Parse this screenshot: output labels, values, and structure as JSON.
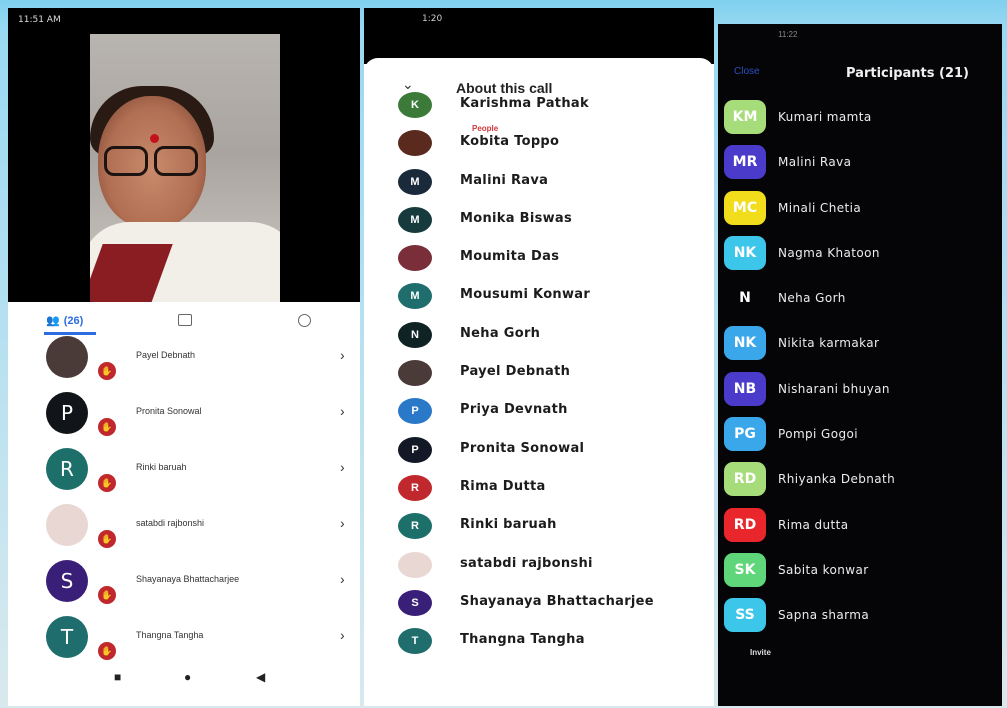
{
  "screen1": {
    "status_text": "11:51 AM",
    "tabs": {
      "people_count": "(26)"
    },
    "participants": [
      {
        "name": "Payel Debnath",
        "initial": "",
        "color": "#4a3a38"
      },
      {
        "name": "Pronita Sonowal",
        "initial": "P",
        "color": "#111418"
      },
      {
        "name": "Rinki baruah",
        "initial": "R",
        "color": "#1d6f6a"
      },
      {
        "name": "satabdi rajbonshi",
        "initial": "",
        "color": "#e9d7d3"
      },
      {
        "name": "Shayanaya Bhattacharjee",
        "initial": "S",
        "color": "#3a1f78"
      },
      {
        "name": "Thangna Tangha",
        "initial": "T",
        "color": "#1f6e6d"
      }
    ],
    "chevron": "›",
    "hand_icon": "✋",
    "nav": {
      "square": "■",
      "home": "●",
      "back": "◀"
    }
  },
  "screen2": {
    "time": "1:20",
    "sheet_title": "About this call",
    "section_label": "People",
    "collapse_glyph": "⌄",
    "participants": [
      {
        "name": "Karishma Pathak",
        "initial": "K",
        "color": "#3c7a3a"
      },
      {
        "name": "Kobita Toppo",
        "initial": "",
        "color": "#5a2a1e"
      },
      {
        "name": "Malini Rava",
        "initial": "M",
        "color": "#1a2a3a"
      },
      {
        "name": "Monika Biswas",
        "initial": "M",
        "color": "#173a3c"
      },
      {
        "name": "Moumita Das",
        "initial": "",
        "color": "#7a2e3a"
      },
      {
        "name": "Mousumi Konwar",
        "initial": "M",
        "color": "#1f6e6d"
      },
      {
        "name": "Neha Gorh",
        "initial": "N",
        "color": "#0f2224"
      },
      {
        "name": "Payel Debnath",
        "initial": "",
        "color": "#4a3a38"
      },
      {
        "name": "Priya Devnath",
        "initial": "P",
        "color": "#2a78c8"
      },
      {
        "name": "Pronita Sonowal",
        "initial": "P",
        "color": "#121826"
      },
      {
        "name": "Rima Dutta",
        "initial": "R",
        "color": "#c0282d"
      },
      {
        "name": "Rinki baruah",
        "initial": "R",
        "color": "#1d6f6a"
      },
      {
        "name": "satabdi rajbonshi",
        "initial": "",
        "color": "#e9d7d3"
      },
      {
        "name": "Shayanaya Bhattacharjee",
        "initial": "S",
        "color": "#3a1f78"
      },
      {
        "name": "Thangna Tangha",
        "initial": "T",
        "color": "#1f6e6d"
      }
    ]
  },
  "screen3": {
    "time": "11:22",
    "back_label": "Close",
    "title": "Participants (21)",
    "invite_label": "Invite",
    "participants": [
      {
        "name": "Kumari mamta",
        "initials": "KM",
        "color": "#a6dd7a"
      },
      {
        "name": "Malini Rava",
        "initials": "MR",
        "color": "#4a3bcb"
      },
      {
        "name": "Minali Chetia",
        "initials": "MC",
        "color": "#f2dd1c"
      },
      {
        "name": "Nagma Khatoon",
        "initials": "NK",
        "color": "#3cc6ea"
      },
      {
        "name": "Neha Gorh",
        "initials": "N",
        "color": "#050507"
      },
      {
        "name": "Nikita karmakar",
        "initials": "NK",
        "color": "#3aa7ea"
      },
      {
        "name": "Nisharani bhuyan",
        "initials": "NB",
        "color": "#4a3bcb"
      },
      {
        "name": "Pompi Gogoi",
        "initials": "PG",
        "color": "#3aa7ea"
      },
      {
        "name": "Rhiyanka Debnath",
        "initials": "RD",
        "color": "#a6dd7a"
      },
      {
        "name": "Rima dutta",
        "initials": "RD",
        "color": "#e8262c"
      },
      {
        "name": "Sabita konwar",
        "initials": "SK",
        "color": "#5fd67a"
      },
      {
        "name": "Sapna sharma",
        "initials": "SS",
        "color": "#3cc6ea"
      }
    ]
  }
}
